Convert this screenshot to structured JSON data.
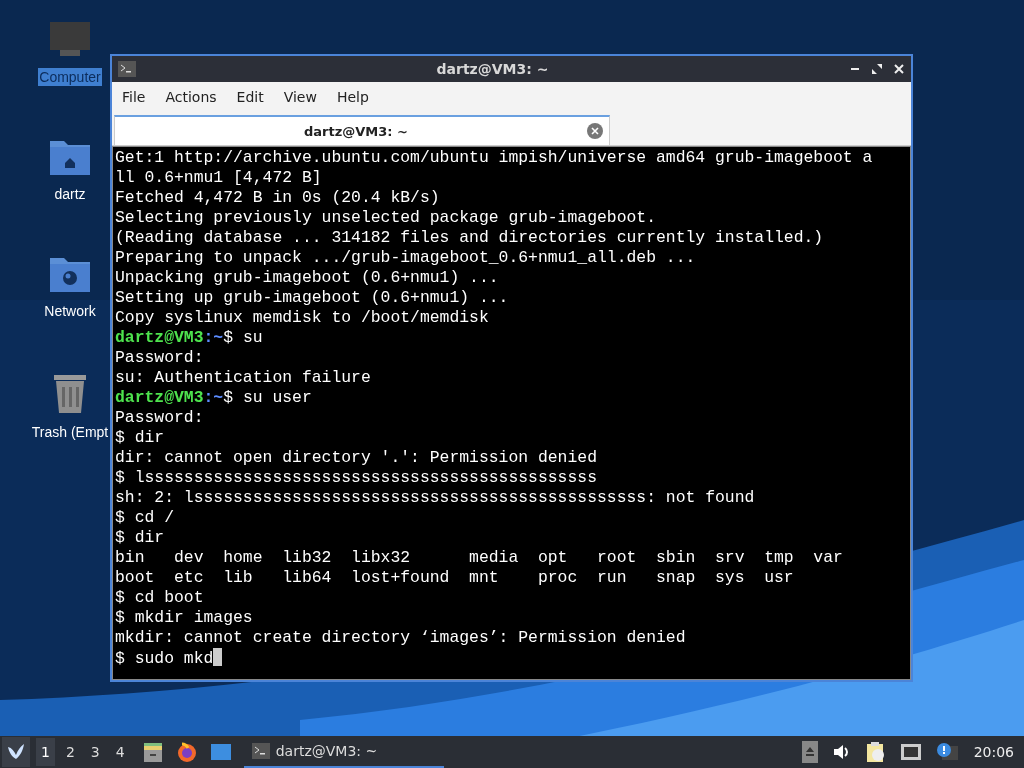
{
  "desktop_icons": [
    {
      "kind": "computer",
      "label": "Computer",
      "selected": true
    },
    {
      "kind": "home",
      "label": "dartz",
      "selected": false
    },
    {
      "kind": "network",
      "label": "Network",
      "selected": false
    },
    {
      "kind": "trash",
      "label": "Trash (Empt",
      "selected": false
    }
  ],
  "window": {
    "title": "dartz@VM3: ~",
    "menu": [
      "File",
      "Actions",
      "Edit",
      "View",
      "Help"
    ],
    "tabs": [
      {
        "label": "dartz@VM3: ~",
        "selected": true
      }
    ],
    "terminal": {
      "lines": [
        {
          "kind": "text",
          "text": "Get:1 http://archive.ubuntu.com/ubuntu impish/universe amd64 grub-imageboot a"
        },
        {
          "kind": "text",
          "text": "ll 0.6+nmu1 [4,472 B]"
        },
        {
          "kind": "text",
          "text": "Fetched 4,472 B in 0s (20.4 kB/s)"
        },
        {
          "kind": "text",
          "text": "Selecting previously unselected package grub-imageboot."
        },
        {
          "kind": "text",
          "text": "(Reading database ... 314182 files and directories currently installed.)"
        },
        {
          "kind": "text",
          "text": "Preparing to unpack .../grub-imageboot_0.6+nmu1_all.deb ..."
        },
        {
          "kind": "text",
          "text": "Unpacking grub-imageboot (0.6+nmu1) ..."
        },
        {
          "kind": "text",
          "text": "Setting up grub-imageboot (0.6+nmu1) ..."
        },
        {
          "kind": "text",
          "text": "Copy syslinux memdisk to /boot/memdisk"
        },
        {
          "kind": "prompt",
          "user": "dartz@VM3",
          "path": ":~",
          "command": "$ su"
        },
        {
          "kind": "text",
          "text": "Password:"
        },
        {
          "kind": "text",
          "text": "su: Authentication failure"
        },
        {
          "kind": "prompt",
          "user": "dartz@VM3",
          "path": ":~",
          "command": "$ su user"
        },
        {
          "kind": "text",
          "text": "Password:"
        },
        {
          "kind": "text",
          "text": "$ dir"
        },
        {
          "kind": "text",
          "text": "dir: cannot open directory '.': Permission denied"
        },
        {
          "kind": "text",
          "text": "$ lssssssssssssssssssssssssssssssssssssssssssssss"
        },
        {
          "kind": "text",
          "text": "sh: 2: lssssssssssssssssssssssssssssssssssssssssssssss: not found"
        },
        {
          "kind": "text",
          "text": "$ cd /"
        },
        {
          "kind": "text",
          "text": "$ dir"
        },
        {
          "kind": "text",
          "text": "bin   dev  home  lib32  libx32      media  opt   root  sbin  srv  tmp  var"
        },
        {
          "kind": "text",
          "text": "boot  etc  lib   lib64  lost+found  mnt    proc  run   snap  sys  usr"
        },
        {
          "kind": "text",
          "text": "$ cd boot"
        },
        {
          "kind": "text",
          "text": "$ mkdir images"
        },
        {
          "kind": "text",
          "text": "mkdir: cannot create directory ‘images’: Permission denied"
        },
        {
          "kind": "input",
          "text": "$ sudo mkd"
        }
      ]
    }
  },
  "taskbar": {
    "workspaces": [
      {
        "label": "1",
        "selected": true
      },
      {
        "label": "2",
        "selected": false
      },
      {
        "label": "3",
        "selected": false
      },
      {
        "label": "4",
        "selected": false
      }
    ],
    "tasks": [
      {
        "label": "dartz@VM3: ~",
        "selected": true
      }
    ],
    "clock": "20:06"
  }
}
